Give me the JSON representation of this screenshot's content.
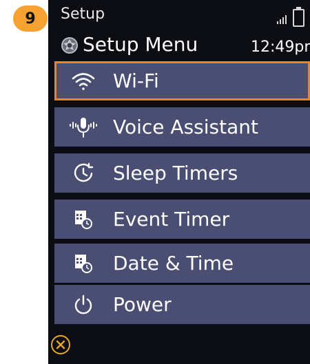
{
  "step_badge": "9",
  "status_bar": {
    "title": "Setup",
    "signal_icon": "signal-icon",
    "battery_icon": "battery-icon"
  },
  "header": {
    "icon": "gear-icon",
    "title": "Setup Menu",
    "clock": "12:49pm"
  },
  "menu": {
    "selected_index": 0,
    "items": [
      {
        "label": "Wi-Fi",
        "icon": "wifi-icon"
      },
      {
        "label": "Voice Assistant",
        "icon": "microphone-icon"
      },
      {
        "label": "Sleep Timers",
        "icon": "sleep-timer-icon"
      },
      {
        "label": "Event Timer",
        "icon": "event-timer-icon"
      },
      {
        "label": "Date & Time",
        "icon": "calendar-clock-icon"
      },
      {
        "label": "Power",
        "icon": "power-icon"
      }
    ]
  },
  "footer": {
    "close_icon": "close-icon"
  },
  "colors": {
    "accent": "#f0841e",
    "badge": "#f5a233",
    "item_bg": "#4a4e73",
    "screen_bg": "#0c0d12",
    "close": "#e6a82a"
  }
}
